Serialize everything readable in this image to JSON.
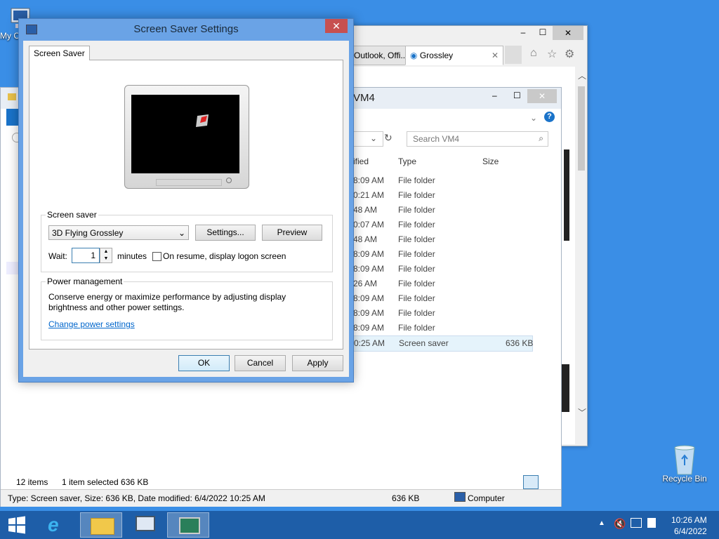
{
  "desktop": {
    "my_computer_label": "My C",
    "recycle_bin_label": "Recycle Bin"
  },
  "browser": {
    "tabs": [
      {
        "label": "Outlook, Offi..."
      },
      {
        "label": "Grossley"
      }
    ]
  },
  "explorer": {
    "title": "VM4",
    "search_placeholder": "Search VM4",
    "columns": {
      "modified": "ified",
      "type": "Type",
      "size": "Size"
    },
    "rows": [
      {
        "modified": "8:09 AM",
        "type": "File folder",
        "size": ""
      },
      {
        "modified": "0:21 AM",
        "type": "File folder",
        "size": ""
      },
      {
        "modified": "48 AM",
        "type": "File folder",
        "size": ""
      },
      {
        "modified": "0:07 AM",
        "type": "File folder",
        "size": ""
      },
      {
        "modified": "48 AM",
        "type": "File folder",
        "size": ""
      },
      {
        "modified": "8:09 AM",
        "type": "File folder",
        "size": ""
      },
      {
        "modified": "8:09 AM",
        "type": "File folder",
        "size": ""
      },
      {
        "modified": "26 AM",
        "type": "File folder",
        "size": ""
      },
      {
        "modified": "8:09 AM",
        "type": "File folder",
        "size": ""
      },
      {
        "modified": "8:09 AM",
        "type": "File folder",
        "size": ""
      },
      {
        "modified": "8:09 AM",
        "type": "File folder",
        "size": ""
      },
      {
        "modified": "0:25 AM",
        "type": "Screen saver",
        "size": "636 KB"
      }
    ],
    "items_count": "12 items",
    "selected_info": "1 item selected  636 KB",
    "status_detail": "Type: Screen saver, Size: 636 KB, Date modified: 6/4/2022 10:25 AM",
    "status_size": "636 KB",
    "status_location": "Computer"
  },
  "dialog": {
    "title": "Screen Saver Settings",
    "close_label": "✕",
    "tab_label": "Screen Saver",
    "screensaver_group": "Screen saver",
    "selected_screensaver": "3D Flying Grossley",
    "settings_label": "Settings...",
    "preview_label": "Preview",
    "wait_label": "Wait:",
    "wait_value": "1",
    "minutes_label": "minutes",
    "resume_label": "On resume, display logon screen",
    "power_group": "Power management",
    "power_text": "Conserve energy or maximize performance by adjusting display brightness and other power settings.",
    "power_link": "Change power settings",
    "ok_label": "OK",
    "cancel_label": "Cancel",
    "apply_label": "Apply"
  },
  "taskbar": {
    "time": "10:26 AM",
    "date": "6/4/2022"
  },
  "colors": {
    "desktop": "#3a8ee6",
    "taskbar": "#1e5ea8",
    "dialog_frame": "#6aa3e6",
    "close_button": "#c75050",
    "link": "#0066cc"
  }
}
